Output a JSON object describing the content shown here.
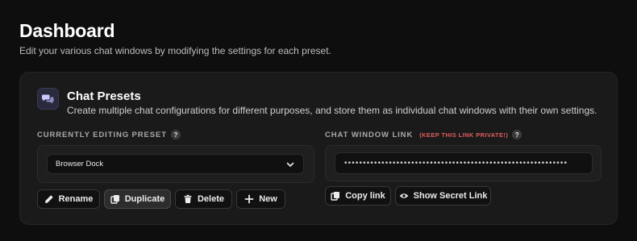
{
  "header": {
    "title": "Dashboard",
    "subtitle": "Edit your various chat windows by modifying the settings for each preset."
  },
  "card": {
    "icon": "chat-bubbles-icon",
    "title": "Chat Presets",
    "description": "Create multiple chat configurations for different purposes, and store them as individual chat windows with their own settings."
  },
  "preset": {
    "label": "CURRENTLY EDITING PRESET",
    "help_glyph": "?",
    "selected": "Browser Dock",
    "buttons": {
      "rename": "Rename",
      "duplicate": "Duplicate",
      "delete": "Delete",
      "new": "New"
    }
  },
  "link": {
    "label": "CHAT WINDOW LINK",
    "warning": "(KEEP THIS LINK PRIVATE!)",
    "help_glyph": "?",
    "masked_value": "••••••••••••••••••••••••••••••••••••••••••••••••••••••••••••",
    "buttons": {
      "copy": "Copy link",
      "show_secret": "Show Secret Link"
    }
  },
  "colors": {
    "background": "#0e0e0e",
    "card": "#1a1a1a",
    "warning": "#e05d5d"
  }
}
